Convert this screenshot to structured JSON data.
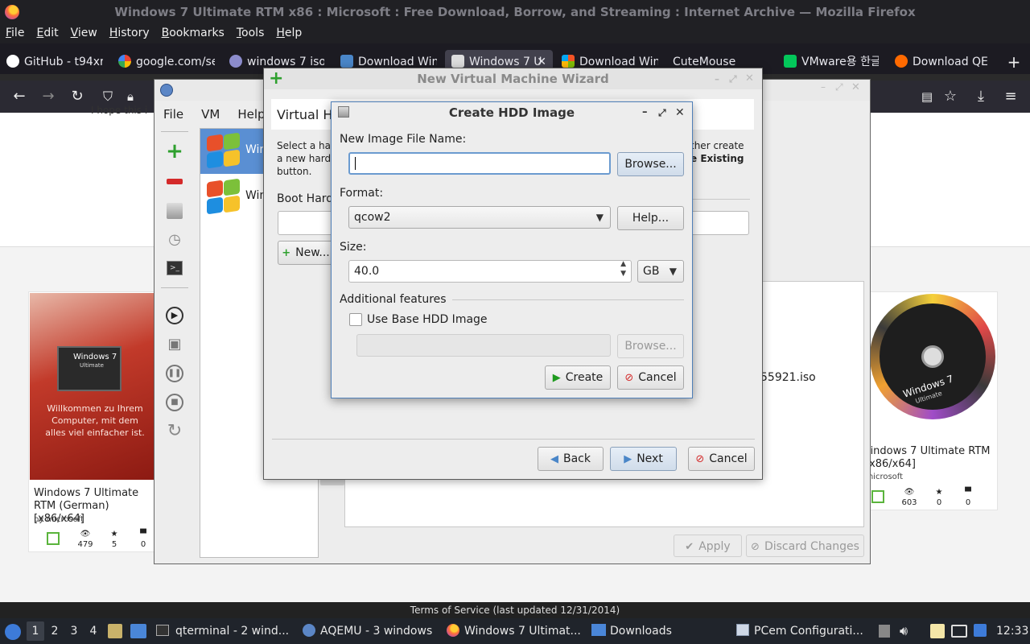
{
  "firefox": {
    "window_title": "Windows 7 Ultimate RTM x86 : Microsoft : Free Download, Borrow, and Streaming : Internet Archive — Mozilla Firefox",
    "menu": [
      "File",
      "Edit",
      "View",
      "History",
      "Bookmarks",
      "Tools",
      "Help"
    ],
    "tabs": [
      "GitHub - t94xr",
      "google.com/se",
      "windows 7 iso",
      "Download Win",
      "Windows 7 U",
      "Download Win",
      "CuteMouse",
      "VMware용 한글",
      "Download QE"
    ],
    "new_tab": "+"
  },
  "page": {
    "snippet": "I hope this i",
    "cards": [
      {
        "title": "Windows 7 Ultimate RTM (German) [x86/x64]",
        "by": "by microsoft",
        "views": "479",
        "favs": "5",
        "reviews": "0",
        "box_text_1": "Windows 7",
        "box_text_2": "Ultimate",
        "box_text_3": "Willkommen zu Ihrem Computer, mit dem alles viel einfacher ist."
      },
      {
        "title": "Windows 7 Ultimate RTM [x86/x64]",
        "by": "by microsoft",
        "views": "603",
        "favs": "0",
        "reviews": "0",
        "disc_text": "Windows 7",
        "disc_sub": "Ultimate"
      }
    ],
    "iso_fragment": "55921.iso",
    "terms": "Terms of Service (last updated 12/31/2014)"
  },
  "aqemu": {
    "menu": [
      "File",
      "VM",
      "Help"
    ],
    "vm_items": [
      "Win",
      "Win"
    ],
    "apply_label": "Apply",
    "discard_label": "Discard Changes"
  },
  "wizard": {
    "title": "New Virtual Machine Wizard",
    "header": "Virtual Hard Disk",
    "desc_line1": "Select a har",
    "desc_line2": "a new hard",
    "desc_line3": "button.",
    "desc_right1": "ther create",
    "desc_right2": "e Existing",
    "boot_label": "Boot Hard",
    "new_label": "New...",
    "back_label": "Back",
    "next_label": "Next",
    "cancel_label": "Cancel"
  },
  "hdd_dialog": {
    "title": "Create HDD Image",
    "name_label": "New Image File Name:",
    "name_value": "",
    "browse_label": "Browse...",
    "format_label": "Format:",
    "format_value": "qcow2",
    "help_label": "Help...",
    "size_label": "Size:",
    "size_value": "40.0",
    "unit_value": "GB",
    "features_label": "Additional features",
    "base_checkbox_label": "Use Base HDD Image",
    "base_checked": false,
    "base_browse_label": "Browse...",
    "create_label": "Create",
    "cancel_label": "Cancel"
  },
  "taskbar": {
    "workspaces": [
      "1",
      "2",
      "3",
      "4"
    ],
    "tasks": [
      "qterminal - 2 wind...",
      "AQEMU - 3 windows",
      "Windows 7 Ultimat...",
      "Downloads",
      "PCem Configurati..."
    ],
    "clock": "12:33"
  }
}
